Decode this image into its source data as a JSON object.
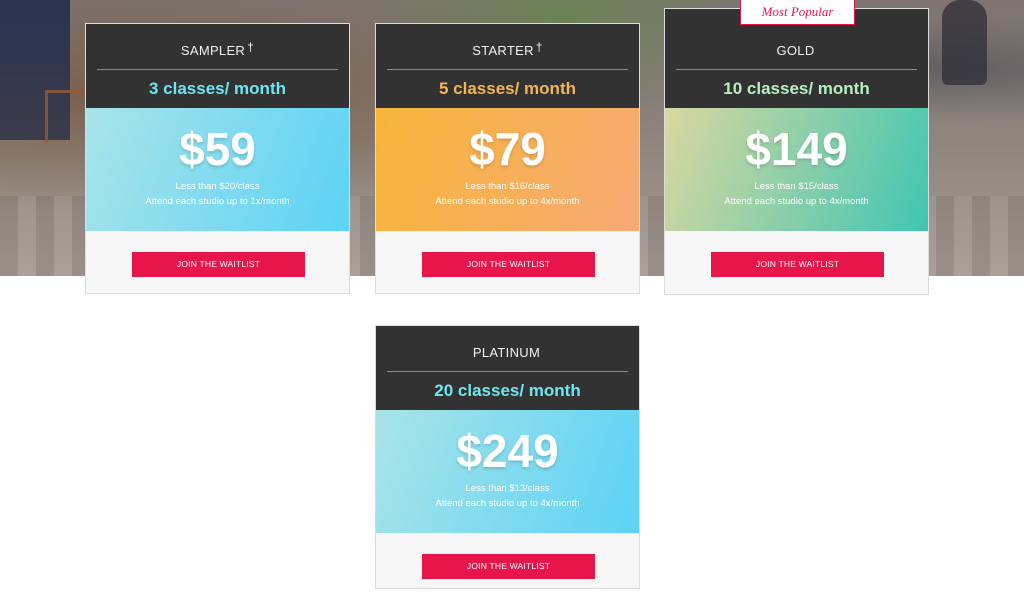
{
  "badge": {
    "label": "Most Popular"
  },
  "plans": [
    {
      "name": "SAMPLER",
      "dagger": "†",
      "classes": "3 classes/ month",
      "price": "$59",
      "per_class": "Less than $20/class",
      "attend": "Attend each studio up to 1x/month",
      "button": "JOIN THE WAITLIST",
      "classes_color": "#6ee6f0",
      "gradient": [
        "#a9e3e8",
        "#5cd3f5"
      ]
    },
    {
      "name": "STARTER",
      "dagger": "†",
      "classes": "5 classes/ month",
      "price": "$79",
      "per_class": "Less than $16/class",
      "attend": "Attend each studio up to 4x/month",
      "button": "JOIN THE WAITLIST",
      "classes_color": "#f2b654",
      "gradient": [
        "#f7b53a",
        "#f7aa74"
      ]
    },
    {
      "name": "GOLD",
      "dagger": "",
      "classes": "10 classes/ month",
      "price": "$149",
      "per_class": "Less than $15/class",
      "attend": "Attend each studio up to 4x/month",
      "button": "JOIN THE WAITLIST",
      "classes_color": "#b8f0c0",
      "gradient": [
        "#d9d8a0",
        "#3fc6b2"
      ]
    },
    {
      "name": "PLATINUM",
      "dagger": "",
      "classes": "20 classes/ month",
      "price": "$249",
      "per_class": "Less than $13/class",
      "attend": "Attend each studio up to 4x/month",
      "button": "JOIN THE WAITLIST",
      "classes_color": "#6ee6f0",
      "gradient": [
        "#a9e3e8",
        "#5cd3f5"
      ]
    }
  ]
}
